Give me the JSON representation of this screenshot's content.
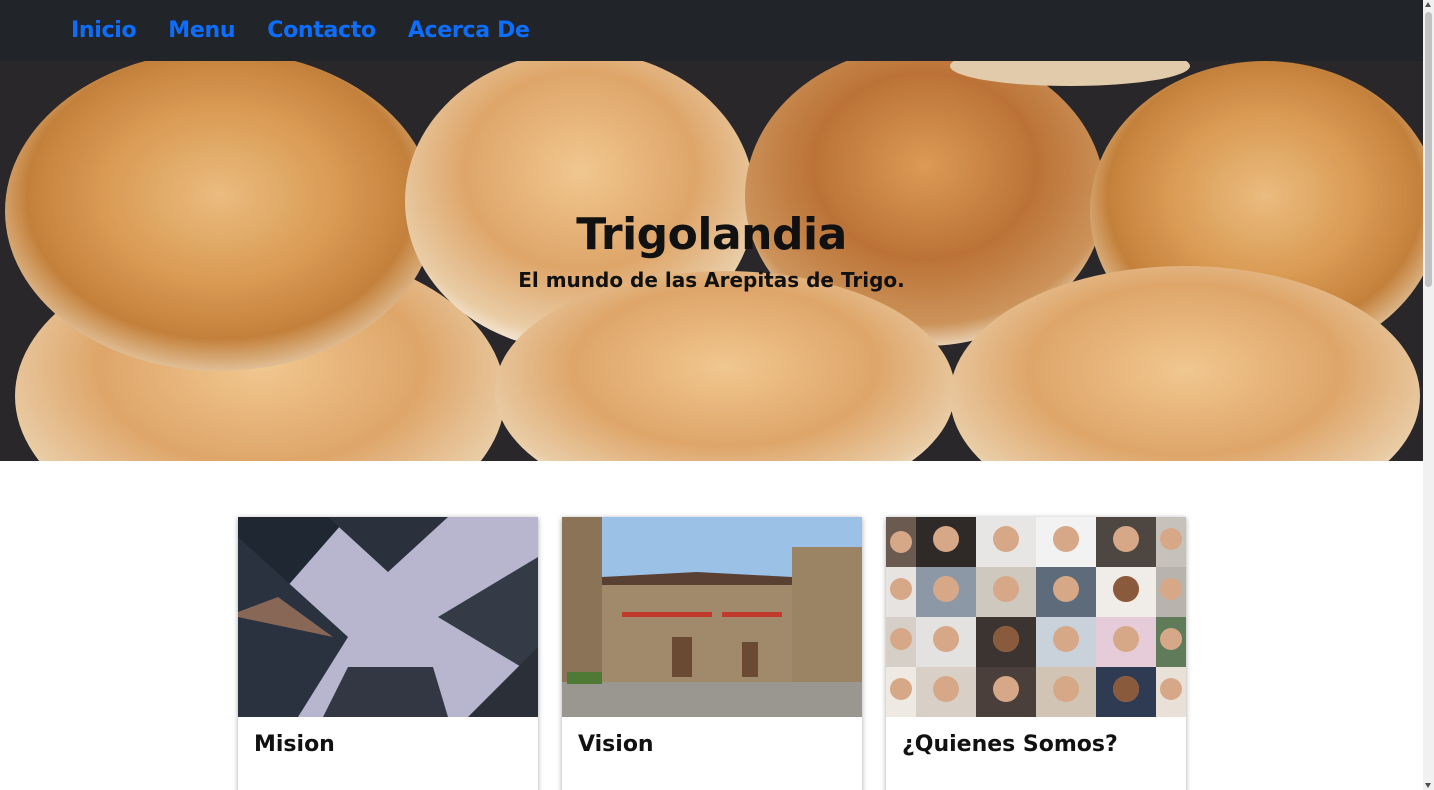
{
  "nav": {
    "items": [
      {
        "label": "Inicio"
      },
      {
        "label": "Menu"
      },
      {
        "label": "Contacto"
      },
      {
        "label": "Acerca De"
      }
    ]
  },
  "hero": {
    "title": "Trigolandia",
    "subtitle": "El mundo de las Arepitas de Trigo.",
    "image": "arepitas-de-trigo-photo"
  },
  "cards": [
    {
      "title": "Mision",
      "image": "skyscrapers-photo"
    },
    {
      "title": "Vision",
      "image": "stone-village-photo"
    },
    {
      "title": "¿Quienes Somos?",
      "image": "people-faces-grid-photo"
    }
  ],
  "colors": {
    "navbar_bg": "#212529",
    "nav_link": "#0d6efd",
    "text": "#111111"
  }
}
